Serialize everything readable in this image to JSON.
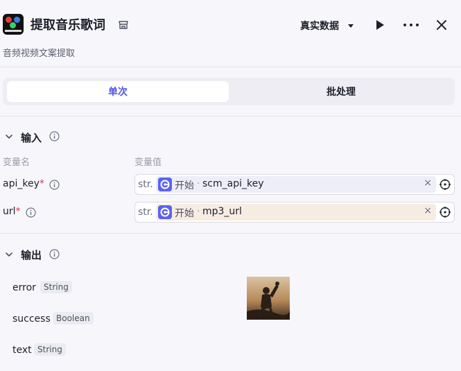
{
  "header": {
    "title": "提取音乐歌词",
    "subtitle": "音频视频文案提取",
    "data_mode": "真实数据",
    "icons": [
      "app-logo",
      "store-icon",
      "chevron-down-icon",
      "play-icon",
      "more-icon",
      "close-icon"
    ]
  },
  "tabs": [
    {
      "label": "单次",
      "active": true
    },
    {
      "label": "批处理",
      "active": false
    }
  ],
  "input_section": {
    "title": "输入",
    "col_name": "变量名",
    "col_value": "变量值",
    "params": [
      {
        "name": "api_key",
        "required": "*",
        "type": "str.",
        "node": "开始",
        "sep": "·",
        "var": "scm_api_key"
      },
      {
        "name": "url",
        "required": "*",
        "type": "str.",
        "node": "开始",
        "sep": "·",
        "var": "mp3_url"
      }
    ],
    "clear_glyph": "×"
  },
  "output_section": {
    "title": "输出",
    "fields": [
      {
        "name": "error",
        "type": "String"
      },
      {
        "name": "success",
        "type": "Boolean"
      },
      {
        "name": "text",
        "type": "String"
      }
    ]
  },
  "colors": {
    "accent": "#4d53e8",
    "node_icon": "#5b62f0",
    "required": "#e0384f",
    "chip_blue": "#edeef7",
    "chip_peach": "#f7ece2"
  }
}
